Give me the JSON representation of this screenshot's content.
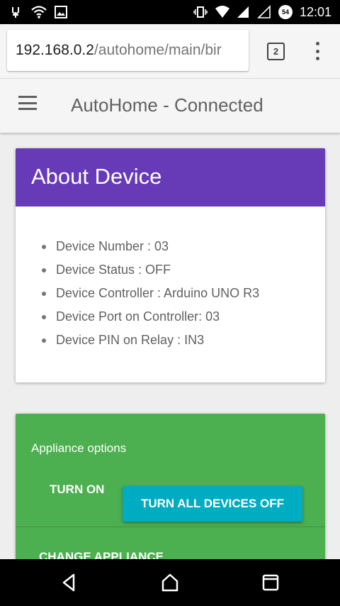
{
  "status_bar": {
    "time": "12:01",
    "notification_badge": "54",
    "icons": [
      "usb-debug-icon",
      "wifi-icon",
      "image-icon",
      "vibrate-icon",
      "wifi-signal-icon",
      "cell-signal-icon",
      "cell-signal-empty-icon"
    ]
  },
  "browser": {
    "url_host": "192.168.0.2",
    "url_path": "/autohome/main/bir",
    "tab_count": "2"
  },
  "app": {
    "title": "AutoHome - Connected"
  },
  "about_device": {
    "title": "About Device",
    "items": [
      "Device Number : 03",
      "Device Status : OFF",
      "Device Controller : Arduino UNO R3",
      "Device Port on Controller: 03",
      "Device PIN on Relay : IN3"
    ]
  },
  "appliance_options": {
    "title": "Appliance options",
    "turn_on_label": "TURN ON",
    "turn_all_off_label": "TURN ALL DEVICES OFF",
    "change_appliance_label": "CHANGE APPLIANCE"
  },
  "colors": {
    "about_header": "#673ab7",
    "options_card": "#4caf50",
    "action_button": "#00acc1"
  }
}
